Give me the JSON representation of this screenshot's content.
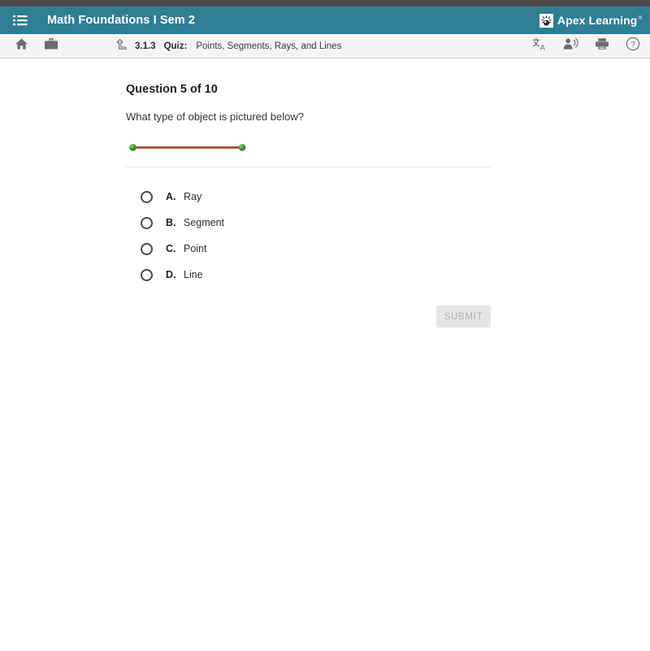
{
  "colors": {
    "top_strip": "#4a4a4a",
    "header_teal": "#2f7e94",
    "toolbar_bg": "#f4f4f4",
    "segment_line": "#a33b31",
    "endpoint_green": "#3c9130",
    "submit_bg": "#e6e6e6",
    "submit_text": "#b0b0b0"
  },
  "header": {
    "menu_icon": "list-menu-icon",
    "title": "Math Foundations I Sem 2",
    "brand_name": "Apex Learning",
    "brand_tm": "®",
    "brand_mark_icon": "apex-sunburst-logo-icon"
  },
  "toolbar": {
    "left_icons": [
      {
        "name": "home-icon",
        "label": "Home"
      },
      {
        "name": "briefcase-icon",
        "label": "Courses"
      }
    ],
    "breadcrumb": {
      "up_icon": "return-up-arrow-icon",
      "number": "3.1.3",
      "type": "Quiz:",
      "title": "Points, Segments, Rays, and Lines"
    },
    "right_icons": [
      {
        "name": "translate-icon",
        "label": "Translate"
      },
      {
        "name": "read-aloud-icon",
        "label": "Read aloud"
      },
      {
        "name": "print-icon",
        "label": "Print"
      },
      {
        "name": "help-icon",
        "label": "Help"
      }
    ]
  },
  "question": {
    "heading": "Question 5 of 10",
    "prompt": "What type of object is pictured below?",
    "figure": {
      "name": "line-segment-figure",
      "description": "A horizontal line segment with two green endpoints",
      "endpoints": 2,
      "line_color": "#a33b31",
      "endpoint_color": "#3c9130"
    },
    "options": [
      {
        "letter": "A.",
        "text": "Ray",
        "selected": false
      },
      {
        "letter": "B.",
        "text": "Segment",
        "selected": false
      },
      {
        "letter": "C.",
        "text": "Point",
        "selected": false
      },
      {
        "letter": "D.",
        "text": "Line",
        "selected": false
      }
    ]
  },
  "submit": {
    "label": "SUBMIT",
    "enabled": false
  }
}
